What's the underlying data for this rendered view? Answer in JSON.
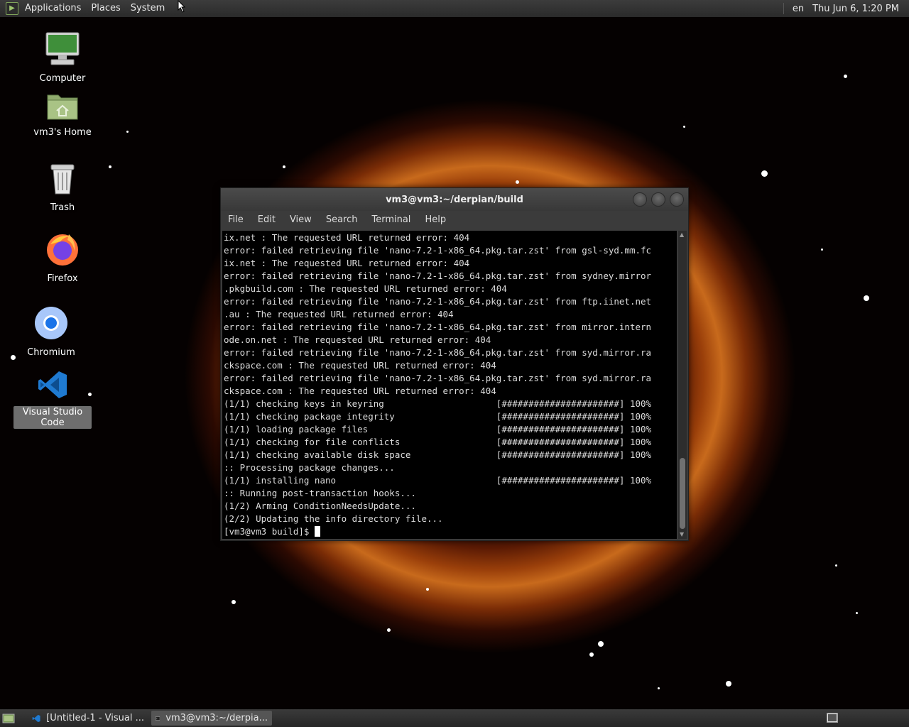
{
  "top_panel": {
    "menus": [
      "Applications",
      "Places",
      "System"
    ],
    "keyboard_layout": "en",
    "clock": "Thu Jun  6, 1:20 PM"
  },
  "desktop_icons": [
    {
      "label": "Computer",
      "icon": "computer-icon"
    },
    {
      "label": "vm3's Home",
      "icon": "home-folder-icon"
    },
    {
      "label": "Trash",
      "icon": "trash-icon"
    },
    {
      "label": "Firefox",
      "icon": "firefox-icon"
    },
    {
      "label": "Chromium",
      "icon": "chromium-icon"
    },
    {
      "label": "Visual Studio Code",
      "icon": "vscode-icon",
      "selected": true
    }
  ],
  "terminal": {
    "title": "vm3@vm3:~/derpian/build",
    "menus": [
      "File",
      "Edit",
      "View",
      "Search",
      "Terminal",
      "Help"
    ],
    "lines": [
      "ix.net : The requested URL returned error: 404",
      "error: failed retrieving file 'nano-7.2-1-x86_64.pkg.tar.zst' from gsl-syd.mm.fc",
      "ix.net : The requested URL returned error: 404",
      "error: failed retrieving file 'nano-7.2-1-x86_64.pkg.tar.zst' from sydney.mirror",
      ".pkgbuild.com : The requested URL returned error: 404",
      "error: failed retrieving file 'nano-7.2-1-x86_64.pkg.tar.zst' from ftp.iinet.net",
      ".au : The requested URL returned error: 404",
      "error: failed retrieving file 'nano-7.2-1-x86_64.pkg.tar.zst' from mirror.intern",
      "ode.on.net : The requested URL returned error: 404",
      "error: failed retrieving file 'nano-7.2-1-x86_64.pkg.tar.zst' from syd.mirror.ra",
      "ckspace.com : The requested URL returned error: 404",
      "error: failed retrieving file 'nano-7.2-1-x86_64.pkg.tar.zst' from syd.mirror.ra",
      "ckspace.com : The requested URL returned error: 404",
      "(1/1) checking keys in keyring                     [######################] 100%",
      "(1/1) checking package integrity                   [######################] 100%",
      "(1/1) loading package files                        [######################] 100%",
      "(1/1) checking for file conflicts                  [######################] 100%",
      "(1/1) checking available disk space                [######################] 100%",
      ":: Processing package changes...",
      "(1/1) installing nano                              [######################] 100%",
      ":: Running post-transaction hooks...",
      "(1/2) Arming ConditionNeedsUpdate...",
      "(2/2) Updating the info directory file..."
    ],
    "prompt": "[vm3@vm3 build]$ "
  },
  "taskbar": {
    "tasks": [
      {
        "label": "[Untitled-1 - Visual ...",
        "icon": "vscode-icon",
        "active": false
      },
      {
        "label": "vm3@vm3:~/derpia...",
        "icon": "terminal-icon",
        "active": true
      }
    ]
  },
  "colors": {
    "panel_bg": "#2e2e2e",
    "terminal_bg": "#000000",
    "terminal_fg": "#dcdcdc",
    "selection_bg": "#6e6e6e"
  }
}
